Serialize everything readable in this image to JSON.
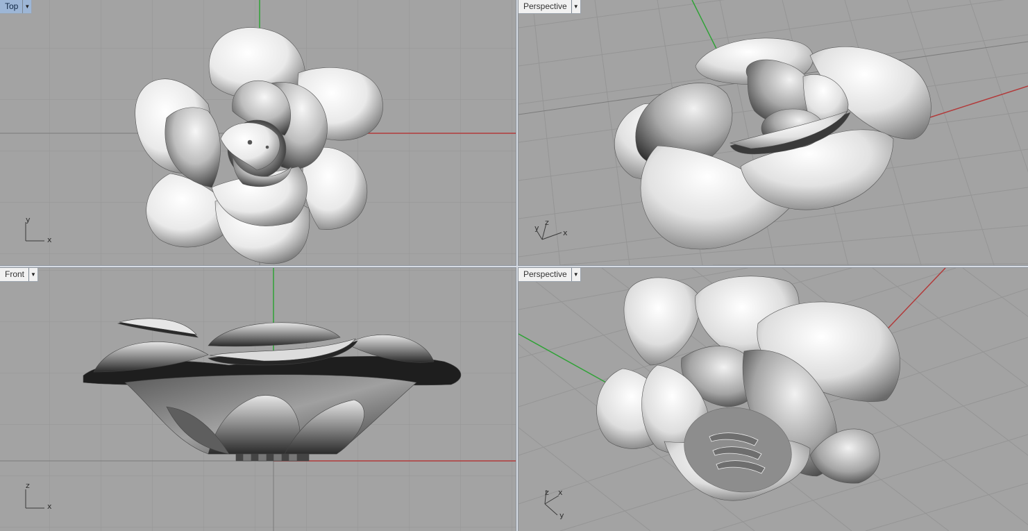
{
  "viewports": {
    "top_left": {
      "name": "Top",
      "active": true,
      "axes": [
        "y",
        "x"
      ]
    },
    "top_right": {
      "name": "Perspective",
      "active": false,
      "axes": [
        "y",
        "z",
        "x"
      ]
    },
    "bottom_left": {
      "name": "Front",
      "active": false,
      "axes": [
        "z",
        "x"
      ]
    },
    "bottom_right": {
      "name": "Perspective",
      "active": false,
      "axes": [
        "z",
        "x",
        "y"
      ]
    }
  },
  "icons": {
    "viewport_menu": "dropdown-arrow-icon"
  },
  "colors": {
    "viewport_bg": "#a3a3a3",
    "grid_line": "#969696",
    "grid_major": "#7f7f7f",
    "x_axis": "#b23a3a",
    "y_axis": "#2fa236",
    "active_tab": "#9db6d6",
    "model_highlight": "#ffffff",
    "model_shadow": "#1a1a1a"
  }
}
